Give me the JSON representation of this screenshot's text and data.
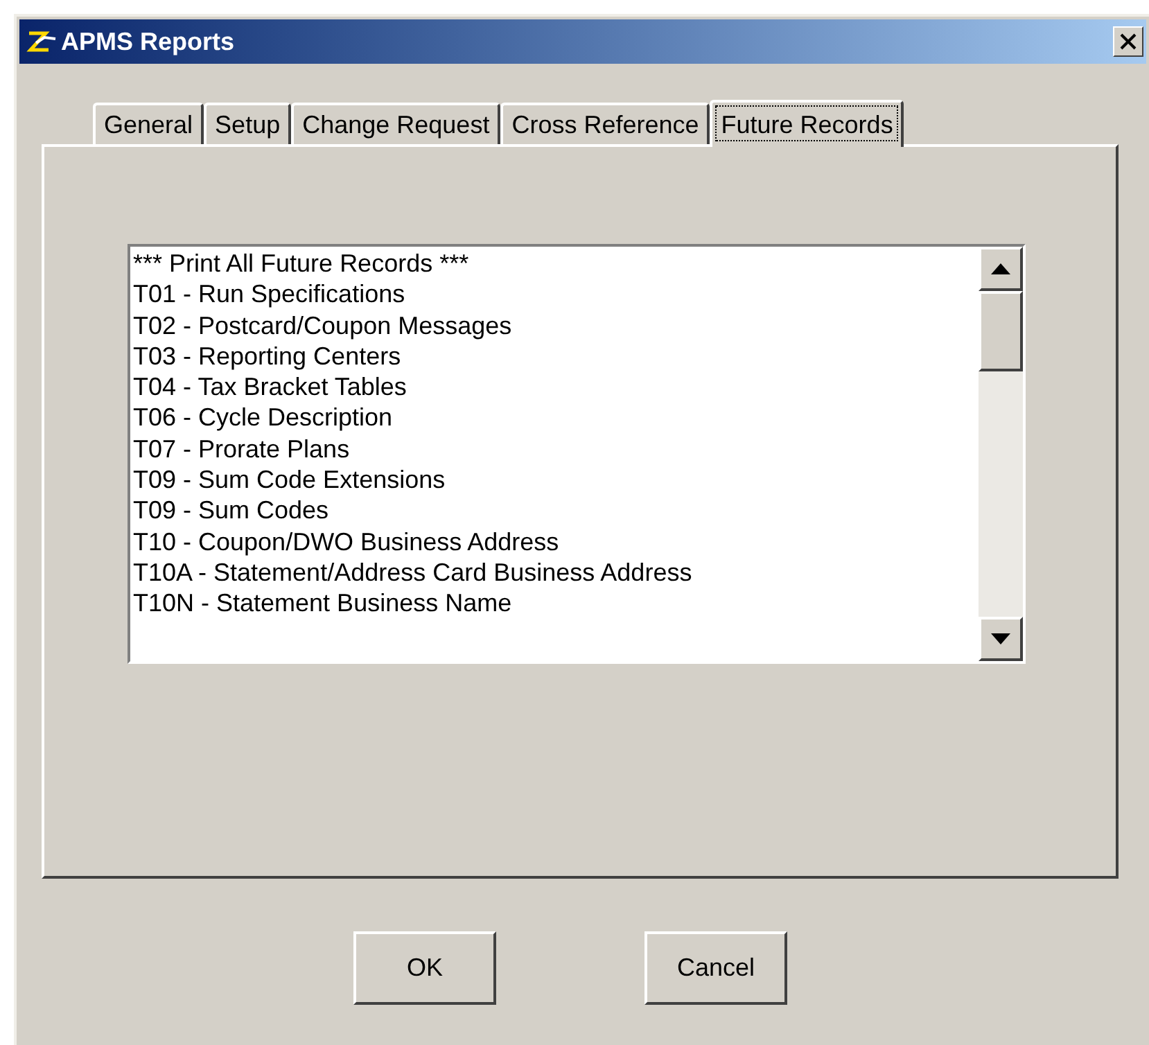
{
  "window": {
    "title": "APMS Reports"
  },
  "tabs": [
    {
      "label": "General",
      "selected": false
    },
    {
      "label": "Setup",
      "selected": false
    },
    {
      "label": "Change Request",
      "selected": false
    },
    {
      "label": "Cross Reference",
      "selected": false
    },
    {
      "label": "Future Records",
      "selected": true
    }
  ],
  "list": {
    "items": [
      "*** Print All Future Records ***",
      "T01 - Run Specifications",
      "T02 - Postcard/Coupon Messages",
      "T03 - Reporting Centers",
      "T04 - Tax Bracket Tables",
      "T06 - Cycle Description",
      "T07 - Prorate Plans",
      "T09 - Sum Code Extensions",
      "T09 - Sum Codes",
      "T10 - Coupon/DWO Business Address",
      "T10A - Statement/Address Card Business Address",
      "T10N - Statement Business Name"
    ]
  },
  "buttons": [
    "OK",
    "Cancel"
  ]
}
